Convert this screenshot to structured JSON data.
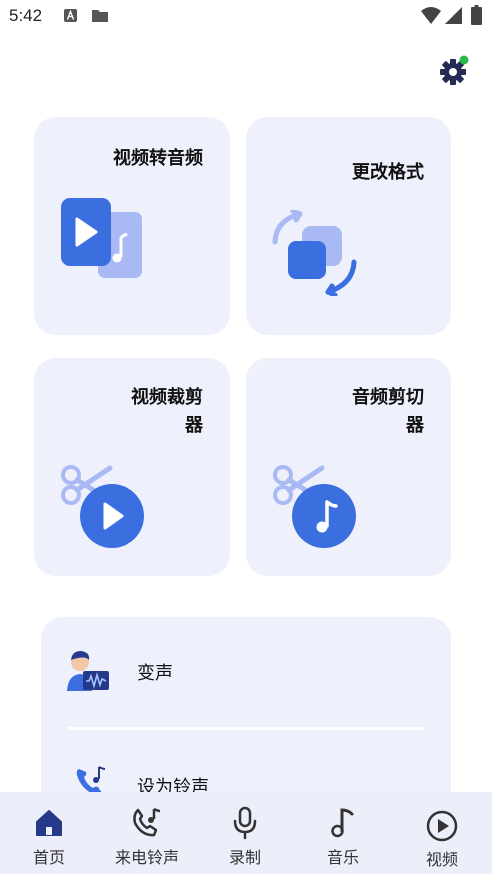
{
  "status_bar": {
    "time": "5:42"
  },
  "header": {
    "settings_icon": "gear-icon"
  },
  "cards": [
    {
      "title_line1": "视频转音频",
      "title_line2": "",
      "icon": "video-to-audio-icon"
    },
    {
      "title_line1": "更改格式",
      "title_line2": "",
      "icon": "format-convert-icon"
    },
    {
      "title_line1": "视频裁剪",
      "title_line2": "器",
      "icon": "video-cut-icon"
    },
    {
      "title_line1": "音频剪切",
      "title_line2": "器",
      "icon": "audio-cut-icon"
    }
  ],
  "list": {
    "items": [
      {
        "label": "变声",
        "icon": "voice-changer-icon"
      },
      {
        "label": "设为铃声",
        "icon": "ringtone-icon"
      }
    ]
  },
  "bottom_nav": {
    "items": [
      {
        "label": "首页",
        "icon": "home-icon",
        "active": true
      },
      {
        "label": "来电铃声",
        "icon": "phone-music-icon",
        "active": false
      },
      {
        "label": "录制",
        "icon": "microphone-icon",
        "active": false
      },
      {
        "label": "音乐",
        "icon": "music-note-icon",
        "active": false
      },
      {
        "label": "视频",
        "icon": "play-circle-icon",
        "active": false
      }
    ]
  },
  "colors": {
    "accent": "#3b6fe0",
    "accent_light": "#a9b9f3",
    "card_bg": "#eef0fc",
    "nav_bg": "#eceef9",
    "badge_green": "#2eb84a",
    "nav_active": "#26388a"
  }
}
